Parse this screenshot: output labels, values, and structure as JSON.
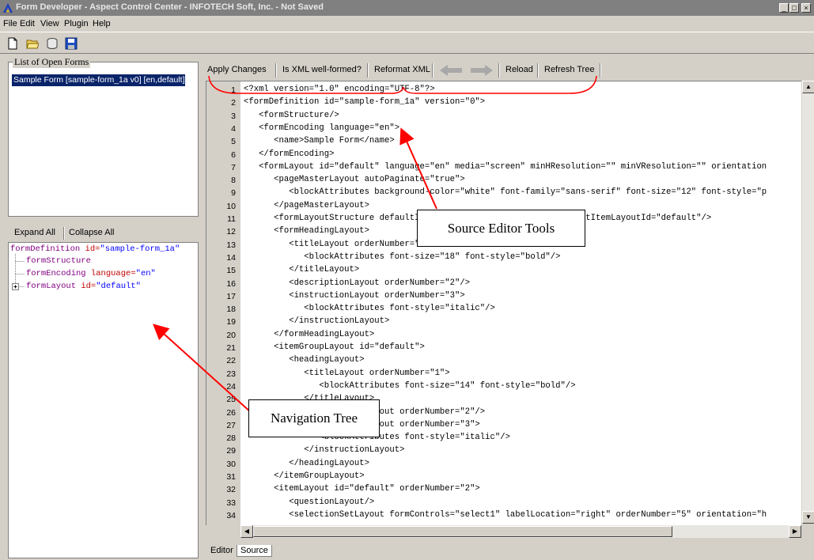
{
  "window": {
    "title": "Form Developer - Aspect Control Center - INFOTECH Soft, Inc. - Not Saved",
    "controls": [
      "_",
      "□",
      "×"
    ]
  },
  "menu": [
    "File",
    "Edit",
    "View",
    "Plugin",
    "Help"
  ],
  "toolbar": {
    "icons": [
      "new-file-icon",
      "open-folder-icon",
      "database-icon",
      "save-icon"
    ]
  },
  "open_forms": {
    "legend": "List of Open Forms",
    "items": [
      "Sample Form [sample-form_1a v0] [en,default]"
    ]
  },
  "tree": {
    "expand_all": "Expand All",
    "collapse_all": "Collapse All",
    "root_tag": "formDefinition",
    "root_attr": " id=",
    "root_val": "\"sample-form_1a\"",
    "n1": "formStructure",
    "n2_tag": "formEncoding",
    "n2_attr": " language=",
    "n2_val": "\"en\"",
    "n3_tag": "formLayout",
    "n3_attr": " id=",
    "n3_val": "\"default\""
  },
  "editor_toolbar": {
    "apply": "Apply Changes",
    "wellformed": "Is XML well-formed?",
    "reformat": "Reformat XML",
    "back_icon": "back-arrow-icon",
    "forward_icon": "forward-arrow-icon",
    "reload": "Reload",
    "refresh": "Refresh Tree"
  },
  "line_numbers": [
    "1",
    "2",
    "3",
    "4",
    "5",
    "6",
    "7",
    "8",
    "9",
    "10",
    "11",
    "12",
    "13",
    "14",
    "15",
    "16",
    "17",
    "18",
    "19",
    "20",
    "21",
    "22",
    "23",
    "24",
    "25",
    "26",
    "27",
    "28",
    "29",
    "30",
    "31",
    "32",
    "33",
    "34"
  ],
  "code_lines": [
    "<?xml version=\"1.0\" encoding=\"UTF-8\"?>",
    "<formDefinition id=\"sample-form_1a\" version=\"0\">",
    "   <formStructure/>",
    "   <formEncoding language=\"en\">",
    "      <name>Sample Form</name>",
    "   </formEncoding>",
    "   <formLayout id=\"default\" language=\"en\" media=\"screen\" minHResolution=\"\" minVResolution=\"\" orientation",
    "      <pageMasterLayout autoPaginate=\"true\">",
    "         <blockAttributes background-color=\"white\" font-family=\"sans-serif\" font-size=\"12\" font-style=\"p",
    "      </pageMasterLayout>",
    "      <formLayoutStructure defaultItemGroupLayoutId=\"default\" defaultItemLayoutId=\"default\"/>",
    "      <formHeadingLayout>",
    "         <titleLayout orderNumber=\"1\">",
    "            <blockAttributes font-size=\"18\" font-style=\"bold\"/>",
    "         </titleLayout>",
    "         <descriptionLayout orderNumber=\"2\"/>",
    "         <instructionLayout orderNumber=\"3\">",
    "            <blockAttributes font-style=\"italic\"/>",
    "         </instructionLayout>",
    "      </formHeadingLayout>",
    "      <itemGroupLayout id=\"default\">",
    "         <headingLayout>",
    "            <titleLayout orderNumber=\"1\">",
    "               <blockAttributes font-size=\"14\" font-style=\"bold\"/>",
    "            </titleLayout>",
    "            <descriptionLayout orderNumber=\"2\"/>",
    "            <instructionLayout orderNumber=\"3\">",
    "               <blockAttributes font-style=\"italic\"/>",
    "            </instructionLayout>",
    "         </headingLayout>",
    "      </itemGroupLayout>",
    "      <itemLayout id=\"default\" orderNumber=\"2\">",
    "         <questionLayout/>",
    "         <selectionSetLayout formControls=\"select1\" labelLocation=\"right\" orderNumber=\"5\" orientation=\"h"
  ],
  "tabs": [
    "Editor",
    "Source"
  ],
  "annotations": {
    "source_editor_tools": "Source Editor Tools",
    "navigation_tree": "Navigation Tree"
  },
  "colors": {
    "annotation_red": "#ff0000",
    "selection": "#0a246a",
    "tree_purple": "#800080",
    "tree_red": "#c00000"
  }
}
